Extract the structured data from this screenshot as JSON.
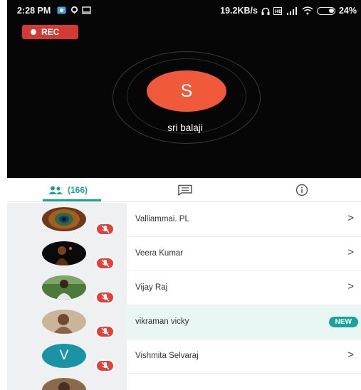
{
  "status_bar": {
    "time": "2:28 PM",
    "network_speed": "19.2KB/s",
    "battery": "24%",
    "icons": [
      "vpn-icon",
      "location-icon",
      "cast-icon",
      "headphones-icon",
      "volte-icon",
      "signal-icon",
      "wifi-icon",
      "battery-icon"
    ]
  },
  "call": {
    "rec_label": "REC",
    "speaker_initial": "S",
    "speaker_name": "sri balaji",
    "colors": {
      "background": "#060606",
      "avatar": "#f05a3a",
      "rec": "#d23a33"
    }
  },
  "tabs": {
    "participants_count": "(166)",
    "participants_icon": "people-icon",
    "chat_icon": "chat-icon",
    "info_icon": "info-icon",
    "accent": "#1aa39a"
  },
  "participants": [
    {
      "name": "Valliammai. PL",
      "avatar": "peacock-feather-photo",
      "muted": true,
      "badge": ""
    },
    {
      "name": "Veera Kumar",
      "avatar": "dark-silhouette-photo",
      "muted": true,
      "badge": ""
    },
    {
      "name": "Vijay Raj",
      "avatar": "man-outdoor-photo",
      "muted": true,
      "badge": ""
    },
    {
      "name": "vikraman vicky",
      "avatar": "sepia-portrait-photo",
      "muted": true,
      "badge": "NEW"
    },
    {
      "name": "Vishmita Selvaraj",
      "avatar_initial": "V",
      "muted": true,
      "badge": ""
    }
  ]
}
